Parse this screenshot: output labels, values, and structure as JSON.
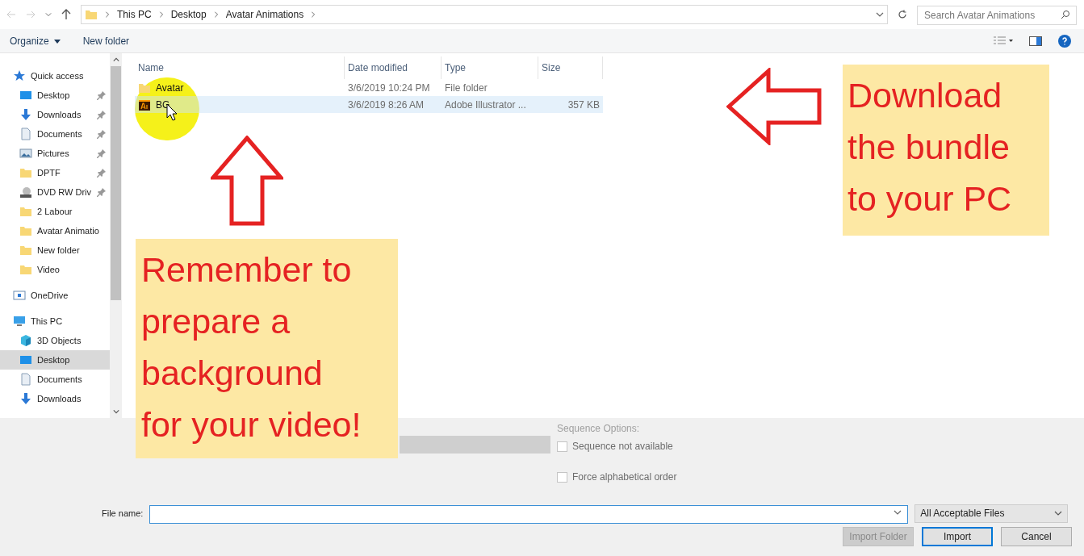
{
  "address_bar": {
    "segments": [
      "This PC",
      "Desktop",
      "Avatar Animations"
    ],
    "search_placeholder": "Search Avatar Animations"
  },
  "toolbar": {
    "organize": "Organize",
    "new_folder": "New folder"
  },
  "sidebar": {
    "items": [
      {
        "label": "Quick access",
        "kind": "star",
        "selected": false,
        "children": [
          {
            "label": "Desktop",
            "kind": "desktop",
            "pinned": true,
            "selected": false
          },
          {
            "label": "Downloads",
            "kind": "download",
            "pinned": true,
            "selected": false
          },
          {
            "label": "Documents",
            "kind": "document",
            "pinned": true,
            "selected": false
          },
          {
            "label": "Pictures",
            "kind": "pictures",
            "pinned": true,
            "selected": false
          },
          {
            "label": "DPTF",
            "kind": "folder",
            "pinned": true,
            "selected": false
          },
          {
            "label": "DVD RW Driv",
            "kind": "dvd",
            "pinned": true,
            "selected": false
          },
          {
            "label": "2 Labour",
            "kind": "folder",
            "pinned": false,
            "selected": false
          },
          {
            "label": "Avatar Animatio",
            "kind": "folder",
            "pinned": false,
            "selected": false
          },
          {
            "label": "New folder",
            "kind": "folder",
            "pinned": false,
            "selected": false
          },
          {
            "label": "Video",
            "kind": "folder",
            "pinned": false,
            "selected": false
          }
        ]
      },
      {
        "label": "OneDrive",
        "kind": "onedrive",
        "selected": false
      },
      {
        "label": "This PC",
        "kind": "pc",
        "selected": false,
        "children": [
          {
            "label": "3D Objects",
            "kind": "cube",
            "pinned": false,
            "selected": false
          },
          {
            "label": "Desktop",
            "kind": "desktop",
            "pinned": false,
            "selected": true
          },
          {
            "label": "Documents",
            "kind": "document",
            "pinned": false,
            "selected": false
          },
          {
            "label": "Downloads",
            "kind": "download",
            "pinned": false,
            "selected": false
          }
        ]
      }
    ]
  },
  "file_list": {
    "columns": [
      "Name",
      "Date modified",
      "Type",
      "Size"
    ],
    "rows": [
      {
        "name": "Avatar",
        "date": "3/6/2019 10:24 PM",
        "type": "File folder",
        "size": "",
        "kind": "folder",
        "selected": false
      },
      {
        "name": "BG",
        "date": "3/6/2019 8:26 AM",
        "type": "Adobe Illustrator ...",
        "size": "357 KB",
        "kind": "illustrator",
        "selected": true
      }
    ]
  },
  "options": {
    "sequence_label": "Sequence Options:",
    "checkboxes": [
      {
        "label": "Sequence not available",
        "checked": false
      },
      {
        "label": "Force alphabetical order",
        "checked": false
      }
    ]
  },
  "footer": {
    "file_name_label": "File name:",
    "file_type": "All Acceptable Files",
    "buttons": [
      {
        "label": "Import Folder",
        "disabled": true,
        "focused": false
      },
      {
        "label": "Import",
        "disabled": false,
        "focused": true
      },
      {
        "label": "Cancel",
        "disabled": false,
        "focused": false
      }
    ]
  },
  "annotations": [
    {
      "text": "Remember to\nprepare a\nbackground\nfor your video!"
    },
    {
      "text": "Download\nthe bundle\nto your PC"
    }
  ]
}
